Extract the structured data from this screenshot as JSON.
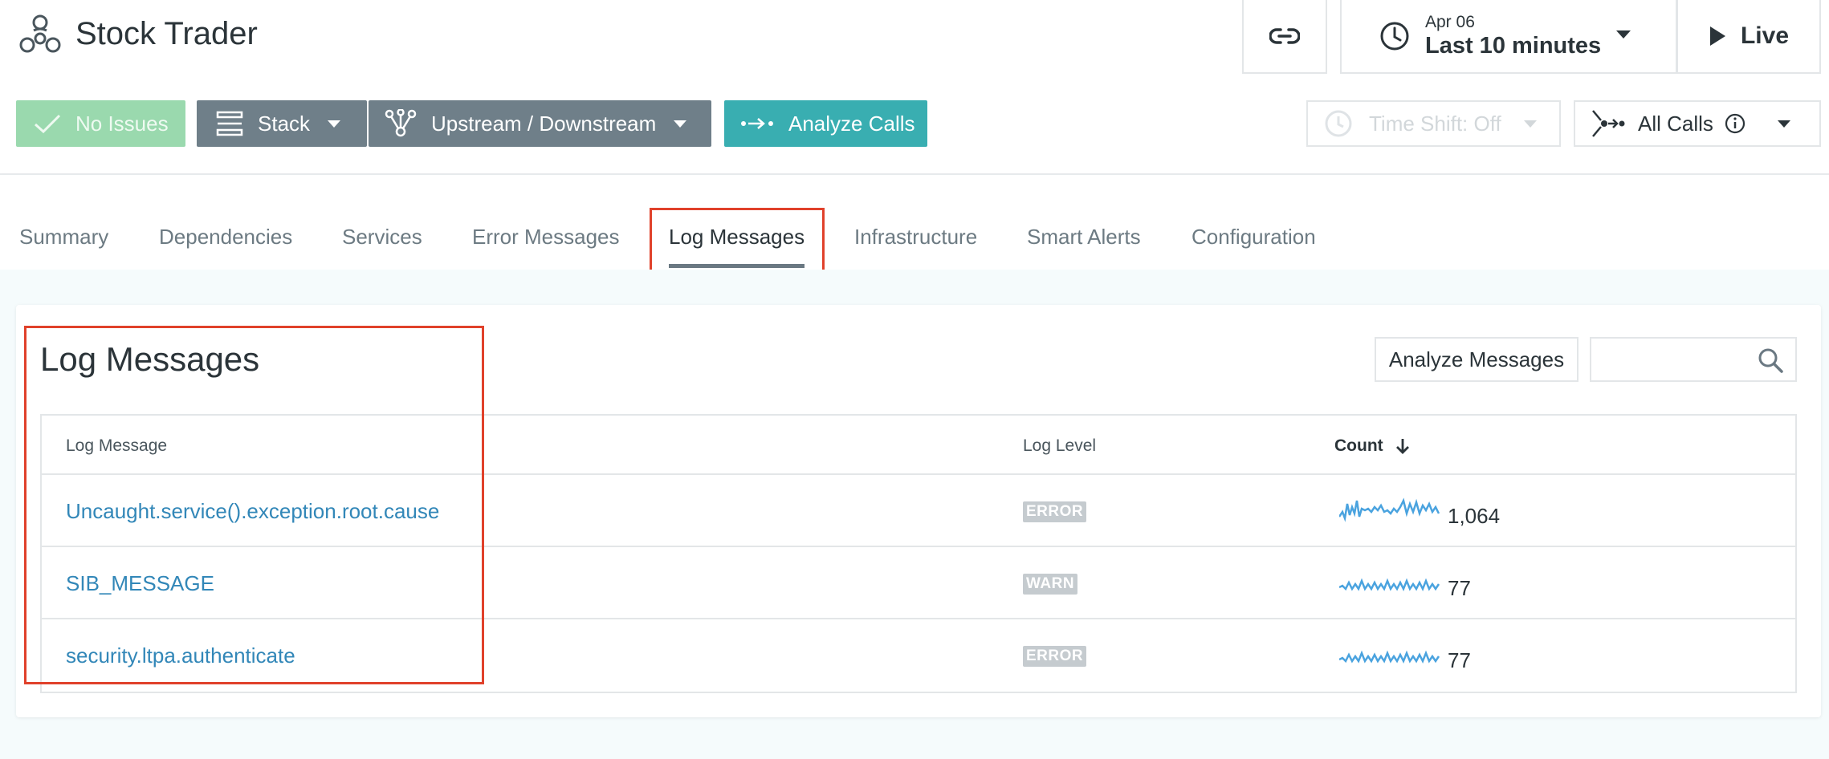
{
  "header": {
    "app_title": "Stock Trader",
    "app_icon": "services-cluster-icon",
    "link_icon": "link-icon",
    "time": {
      "date": "Apr 06",
      "range": "Last 10 minutes",
      "icon": "clock-icon"
    },
    "live": {
      "label": "Live",
      "icon": "play-icon"
    }
  },
  "toolbar": {
    "no_issues": "No Issues",
    "stack": "Stack",
    "upstream_downstream": "Upstream / Downstream",
    "analyze_calls": "Analyze Calls",
    "time_shift": "Time Shift: Off",
    "all_calls": "All Calls"
  },
  "tabs": [
    {
      "label": "Summary"
    },
    {
      "label": "Dependencies"
    },
    {
      "label": "Services"
    },
    {
      "label": "Error Messages"
    },
    {
      "label": "Log Messages",
      "active": true
    },
    {
      "label": "Infrastructure"
    },
    {
      "label": "Smart Alerts"
    },
    {
      "label": "Configuration"
    }
  ],
  "panel": {
    "title": "Log Messages",
    "analyze_button": "Analyze Messages",
    "search_placeholder": ""
  },
  "table": {
    "columns": [
      "Log Message",
      "Log Level",
      "Count"
    ],
    "rows": [
      {
        "message": "Uncaught.service().exception.root.cause",
        "level": "ERROR",
        "count": "1,064"
      },
      {
        "message": "SIB_MESSAGE",
        "level": "WARN",
        "count": "77"
      },
      {
        "message": "security.ltpa.authenticate",
        "level": "ERROR",
        "count": "77"
      }
    ]
  },
  "colors": {
    "accent_teal": "#39aeb1",
    "success_green": "#9ad9ae",
    "button_gray": "#6f7f89",
    "link_blue": "#3287b8",
    "highlight_red": "#e0412b",
    "sparkline_blue": "#4aa3df"
  }
}
